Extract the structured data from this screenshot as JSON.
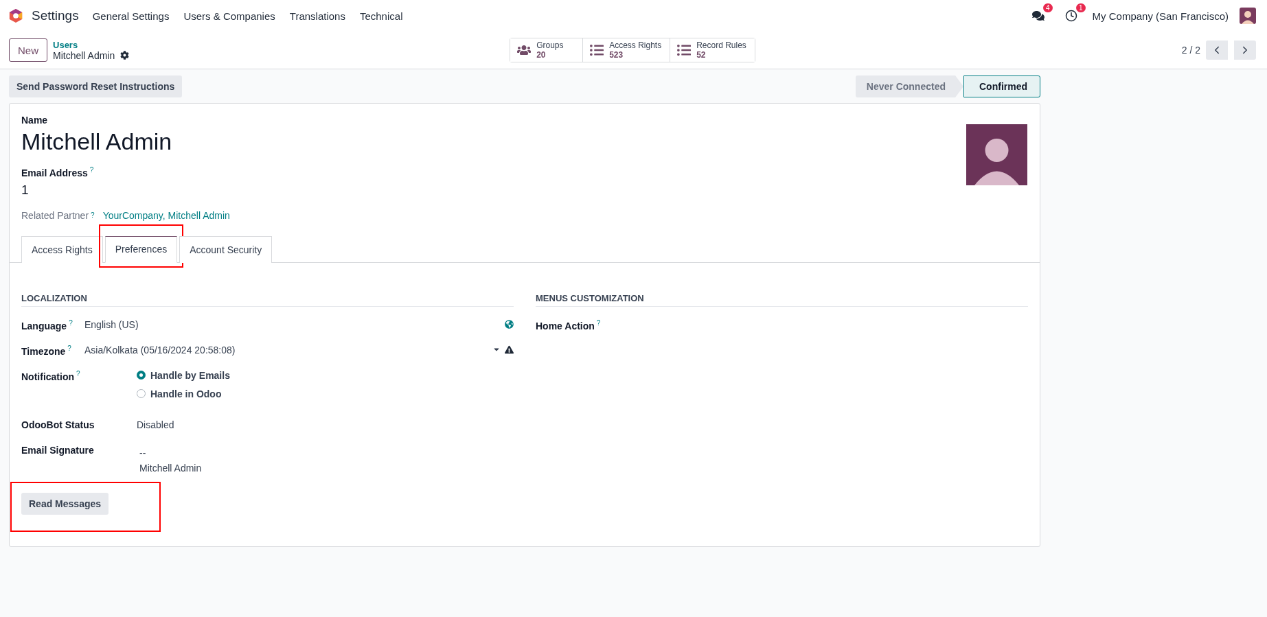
{
  "nav": {
    "app": "Settings",
    "menu": [
      "General Settings",
      "Users & Companies",
      "Translations",
      "Technical"
    ]
  },
  "systray": {
    "messages_count": "4",
    "activities_count": "1",
    "company": "My Company (San Francisco)"
  },
  "control_panel": {
    "new_button": "New",
    "breadcrumb": "Users",
    "record": "Mitchell Admin",
    "smart_buttons": [
      {
        "kind": "groups",
        "label": "Groups",
        "value": "20"
      },
      {
        "kind": "list",
        "label": "Access Rights",
        "value": "523"
      },
      {
        "kind": "list",
        "label": "Record Rules",
        "value": "52"
      }
    ],
    "pager": "2 / 2"
  },
  "action_bar": {
    "button": "Send Password Reset Instructions",
    "statusbar": [
      {
        "label": "Never Connected",
        "selected": false
      },
      {
        "label": "Confirmed",
        "selected": true
      }
    ]
  },
  "form": {
    "name_label": "Name",
    "name": "Mitchell Admin",
    "email_label": "Email Address",
    "email_help": "?",
    "email": "1",
    "partner_label": "Related Partner",
    "partner_help": "?",
    "partner": "YourCompany, Mitchell Admin",
    "tabs": [
      {
        "label": "Access Rights",
        "selected": false,
        "highlighted": false
      },
      {
        "label": "Preferences",
        "selected": true,
        "highlighted": true
      },
      {
        "label": "Account Security",
        "selected": false,
        "highlighted": false
      }
    ],
    "left_section": {
      "title": "LOCALIZATION",
      "fields": [
        {
          "kind": "language",
          "label": "Language",
          "help": "?",
          "value": "English (US)"
        },
        {
          "kind": "timezone",
          "label": "Timezone",
          "help": "?",
          "value": "Asia/Kolkata (05/16/2024 20:58:08)"
        },
        {
          "kind": "radio",
          "label": "Notification",
          "help": "?",
          "options": [
            {
              "label": "Handle by Emails",
              "selected": true
            },
            {
              "label": "Handle in Odoo",
              "selected": false
            }
          ]
        },
        {
          "kind": "text",
          "label": "OdooBot Status",
          "value": "Disabled"
        },
        {
          "kind": "lines",
          "label": "Email Signature",
          "lines": [
            "--",
            "Mitchell Admin"
          ]
        }
      ]
    },
    "right_section": {
      "title": "MENUS CUSTOMIZATION",
      "fields": [
        {
          "label": "Home Action",
          "help": "?"
        }
      ]
    },
    "read_button": {
      "label": "Read Messages",
      "highlighted": true
    }
  }
}
